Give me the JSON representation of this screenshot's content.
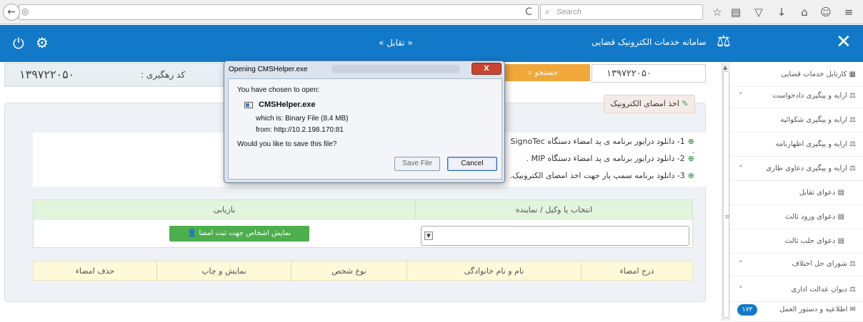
{
  "browser": {
    "search_placeholder": "Search",
    "reload_glyph": "C",
    "icons": [
      "star-icon",
      "clipboard-icon",
      "pocket-icon",
      "download-icon",
      "home-icon",
      "chat-icon",
      "menu-icon"
    ]
  },
  "header": {
    "page_caption": "« تقابل »",
    "system_title": "سامانه خدمات الکترونیک قضایی",
    "background": "#1279c9"
  },
  "tracking": {
    "label": "کد رهگیری :",
    "code": "۱۳۹۷۲۲۰۵۰",
    "input_value": "۱۳۹۷۲۲۰۵۰",
    "search_button": "جستجو"
  },
  "main": {
    "sign_tag": "اخذ امضای الکترونیک",
    "downloads": [
      "1- دانلود درایور برنامه ی پد امضاء دستگاه SignoTec .",
      "2- دانلود درایور برنامه ی پد امضاء دستگاه MIP .",
      "3- دانلود برنامه سمپ پار جهت اخذ امضای الکترونیک."
    ]
  },
  "assignment": {
    "col_left": "بازیابی",
    "col_right": "انتخاب یا وکیل / نماینده",
    "show_people_button": "نمایش اشخاص جهت ثبت امضا"
  },
  "signers_table": {
    "columns": [
      "حذف امضاء",
      "نمایش و چاپ",
      "نوع شخص",
      "نام و نام خانوادگی",
      "درج امضاء"
    ]
  },
  "sidebar": {
    "items": [
      {
        "label": "کارتابل خدمات قضایی",
        "chevron": ""
      },
      {
        "label": "ارایه و پیگیری دادخواست",
        "chevron": "˅"
      },
      {
        "label": "ارایه و پیگیری شکوائیه",
        "chevron": ""
      },
      {
        "label": "ارایه و پیگیری اظهارنامه",
        "chevron": ""
      },
      {
        "label": "ارایه و پیگیری دعاوی طاری",
        "chevron": "˄"
      },
      {
        "label": "دعوای تقابل",
        "chevron": ""
      },
      {
        "label": "دعوای ورود ثالث",
        "chevron": ""
      },
      {
        "label": "دعوای جلب ثالث",
        "chevron": ""
      },
      {
        "label": "شورای حل اختلاف",
        "chevron": "˅"
      },
      {
        "label": "دیوان عدالت اداری",
        "chevron": "˅"
      },
      {
        "label": "اطلاعیه و دستور العمل",
        "chevron": ""
      }
    ],
    "badge": "۱۷۳"
  },
  "dialog": {
    "title": "Opening CMSHelper.exe",
    "close": "X",
    "intro": "You have chosen to open:",
    "filename": "CMSHelper.exe",
    "which_is": "which is: Binary File (8.4 MB)",
    "from": "from: http://10.2.198.170:81",
    "question": "Would you like to save this file?",
    "save_button": "Save File",
    "cancel_button": "Cancel"
  }
}
